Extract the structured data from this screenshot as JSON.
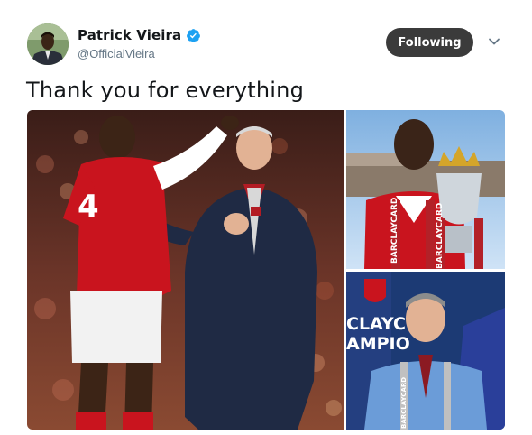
{
  "tweet": {
    "display_name": "Patrick Vieira",
    "handle": "@OfficialVieira",
    "verified": true,
    "text": "Thank you for everything",
    "follow_button_label": "Following",
    "icons": {
      "verified": "verified-badge-icon",
      "more": "chevron-down-icon"
    },
    "colors": {
      "verified": "#1da1f2",
      "follow_button_bg": "#3b3b3b",
      "handle": "#657786"
    },
    "media": {
      "photo_count": 3,
      "photo_main_text": [
        "4"
      ],
      "photo_top_right_text": [
        "BARCLAYCARD",
        "BARCLAYCARD"
      ],
      "photo_bottom_right_text": [
        "CLAYC",
        "AMPIO",
        "BARCLAYCARD"
      ]
    }
  }
}
